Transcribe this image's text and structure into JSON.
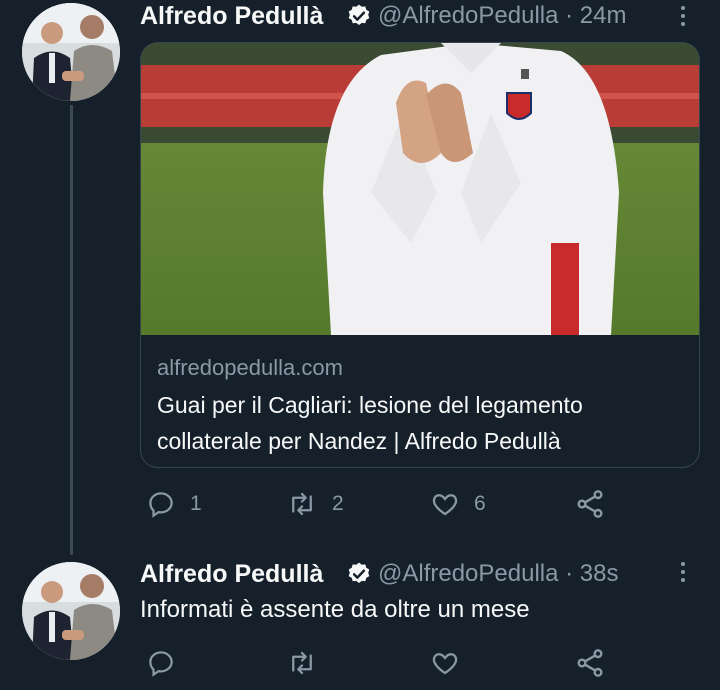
{
  "colors": {
    "background": "#15202b",
    "text": "#f7f9f9",
    "muted": "#8b98a5",
    "border": "#38444d",
    "verified": "#f7f9f9"
  },
  "tweets": [
    {
      "author_name": "Alfredo Pedullà",
      "handle_time": "@AlfredoPedulla · 24m",
      "card": {
        "domain": "alfredopedulla.com",
        "title": "Guai per il Cagliari: lesione del legamento collaterale per Nandez | Alfredo Pedullà"
      },
      "actions": {
        "reply_count": "1",
        "retweet_count": "2",
        "like_count": "6"
      },
      "icons": [
        "reply-icon",
        "retweet-icon",
        "like-icon",
        "share-icon",
        "verified-badge-icon",
        "more-options-icon"
      ]
    },
    {
      "author_name": "Alfredo Pedullà",
      "handle_time": "@AlfredoPedulla · 38s",
      "text": "Informati è assente da oltre un mese",
      "actions": {
        "reply_count": "",
        "retweet_count": "",
        "like_count": ""
      }
    }
  ]
}
